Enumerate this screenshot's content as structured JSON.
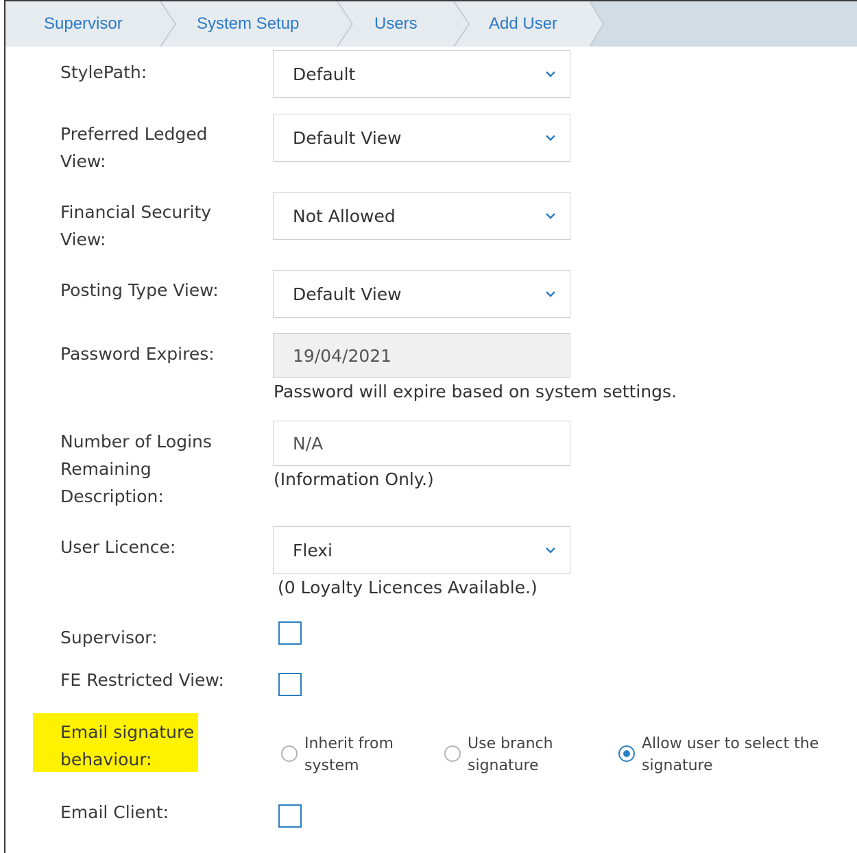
{
  "breadcrumb": {
    "items": [
      "Supervisor",
      "System Setup",
      "Users",
      "Add User"
    ]
  },
  "form": {
    "style_path": {
      "label": "StylePath:",
      "value": "Default"
    },
    "preferred_ledger_view": {
      "label_line1": "Preferred Ledged",
      "label_line2": "View:",
      "value": "Default View"
    },
    "financial_security_view": {
      "label_line1": "Financial Security",
      "label_line2": "View:",
      "value": "Not Allowed"
    },
    "posting_type_view": {
      "label": "Posting Type View:",
      "value": "Default View"
    },
    "password_expires": {
      "label": "Password Expires:",
      "value": "19/04/2021",
      "note": "Password will expire based on system settings."
    },
    "logins_remaining": {
      "label_line1": "Number of Logins",
      "label_line2": "Remaining",
      "label_line3": "Description:",
      "value": "N/A",
      "note": "(Information Only.)"
    },
    "user_licence": {
      "label": "User Licence:",
      "value": "Flexi",
      "note": "(0 Loyalty Licences Available.)"
    },
    "supervisor": {
      "label": "Supervisor:",
      "checked": false
    },
    "fe_restricted_view": {
      "label": "FE Restricted View:",
      "checked": false
    },
    "email_signature": {
      "label_line1": "Email signature",
      "label_line2": "behaviour:",
      "options": [
        {
          "line1": "Inherit from",
          "line2": "system",
          "selected": false
        },
        {
          "line1": "Use branch",
          "line2": "signature",
          "selected": false
        },
        {
          "line1": "Allow user to select the",
          "line2": "signature",
          "selected": true
        }
      ]
    },
    "email_client": {
      "label": "Email Client:",
      "checked": false
    }
  },
  "colors": {
    "accent": "#2a7fc4",
    "link": "#2b7ac8",
    "highlight": "#fff200",
    "breadcrumb_bg": "#e6ebef"
  }
}
